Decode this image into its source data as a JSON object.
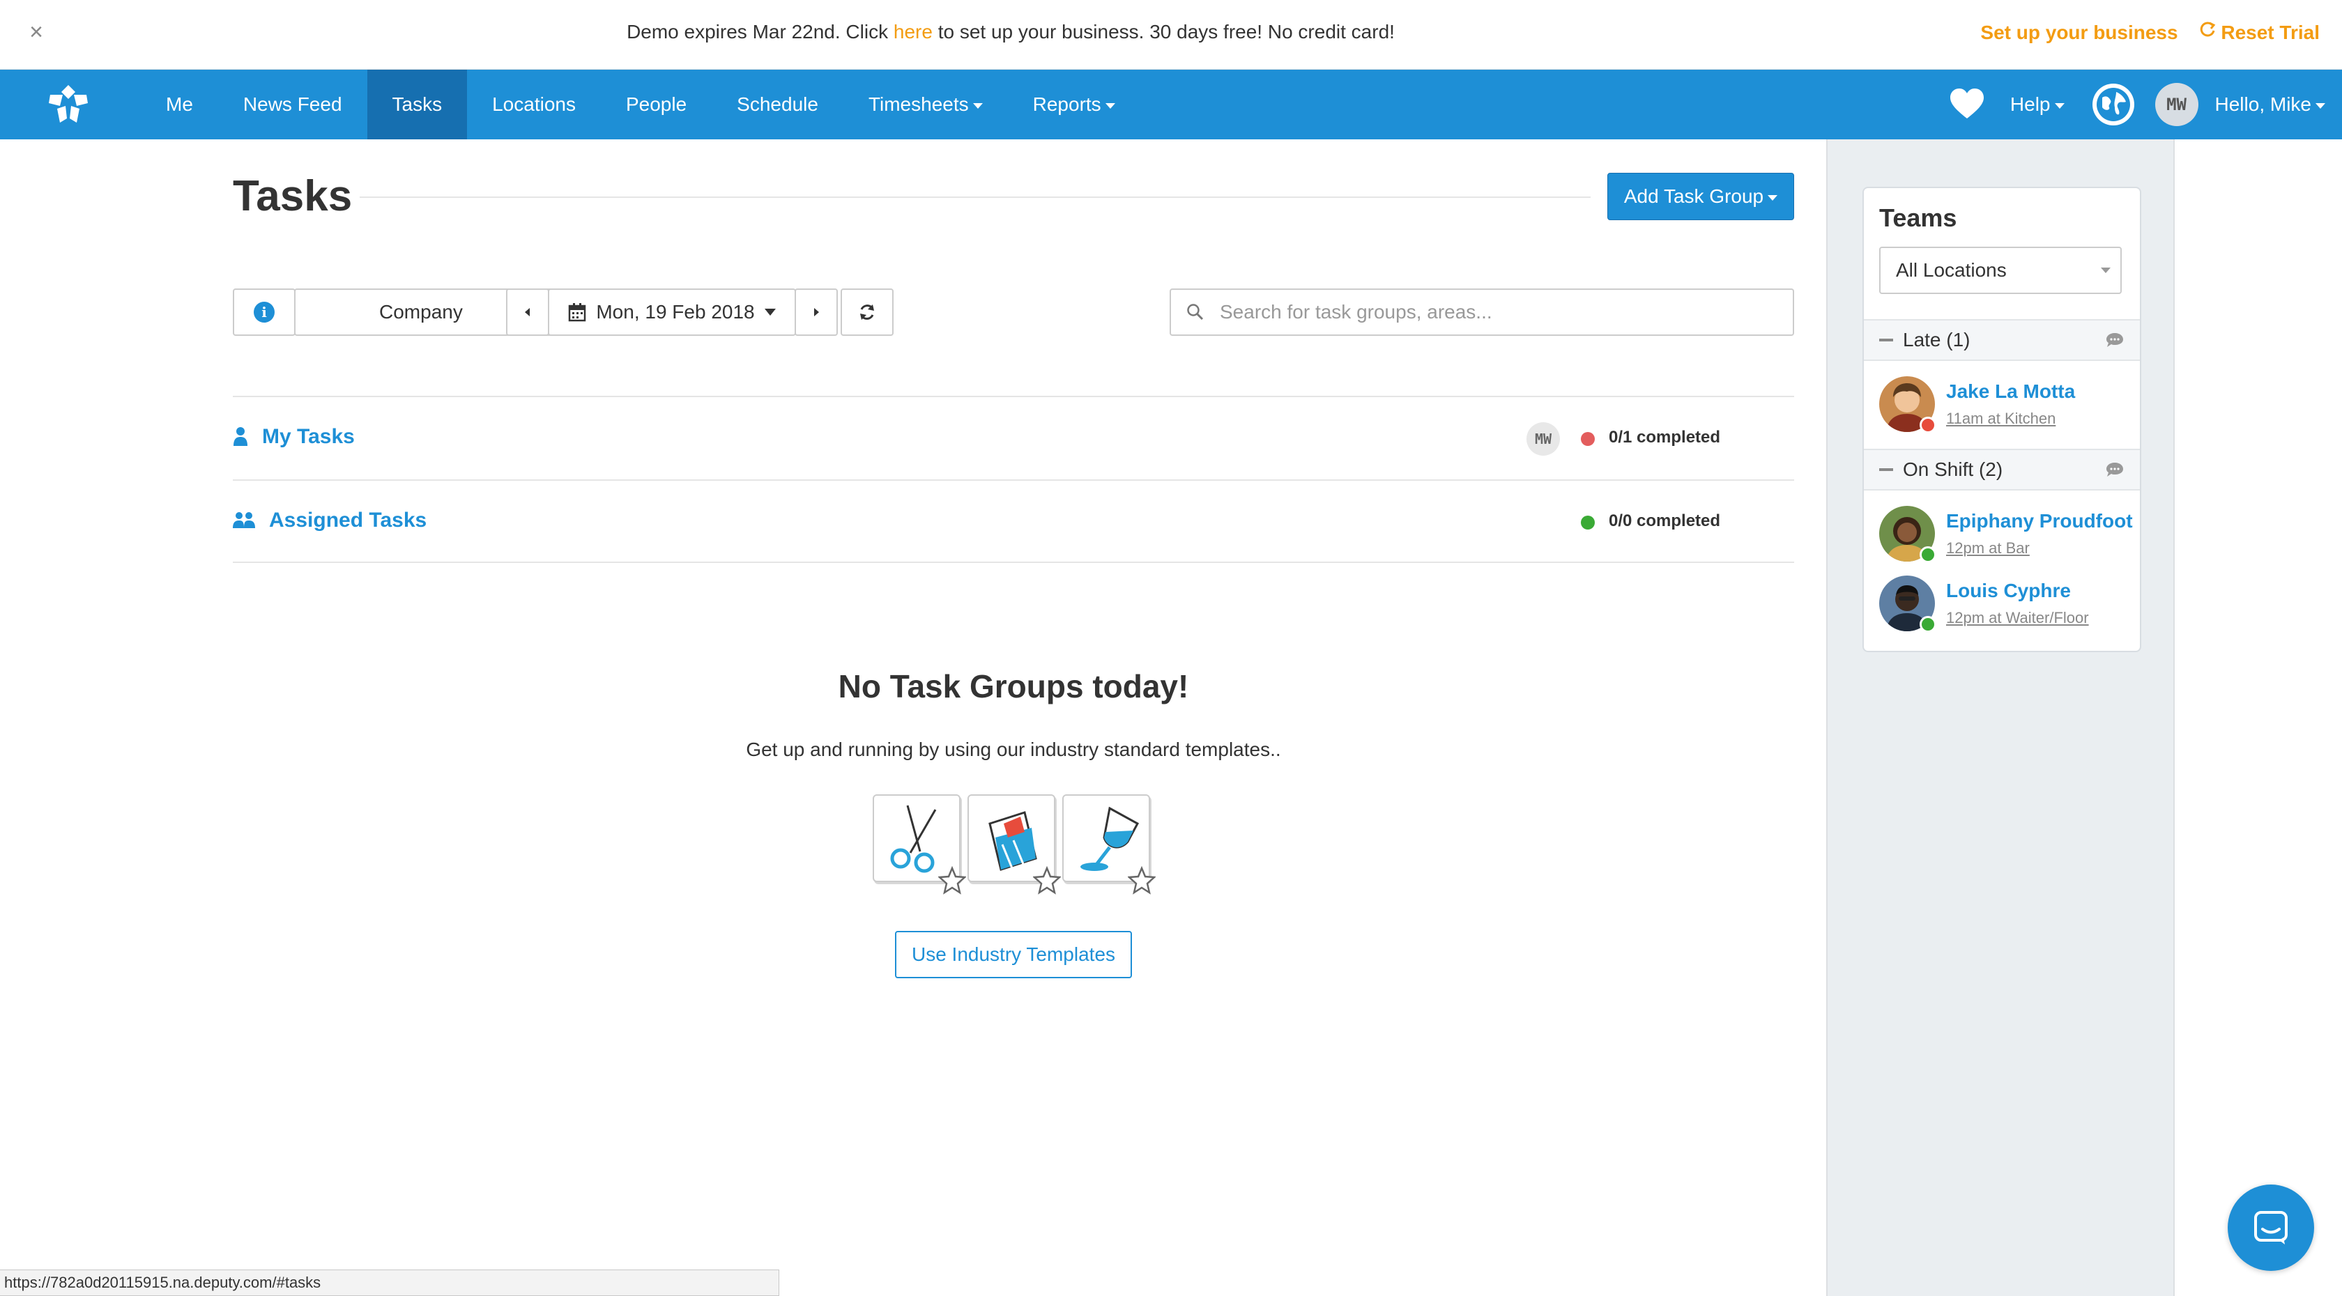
{
  "demo_bar": {
    "close": "×",
    "msg_pre": "Demo expires Mar 22nd. Click",
    "msg_link": "here",
    "msg_post": "to set up your business. 30 days free! No credit card!",
    "setup": "Set up your business",
    "reset": "Reset Trial"
  },
  "nav": {
    "items": [
      {
        "label": "Me"
      },
      {
        "label": "News Feed"
      },
      {
        "label": "Tasks",
        "active": true
      },
      {
        "label": "Locations"
      },
      {
        "label": "People"
      },
      {
        "label": "Schedule"
      },
      {
        "label": "Timesheets",
        "dropdown": true
      },
      {
        "label": "Reports",
        "dropdown": true
      }
    ],
    "help": "Help",
    "initials": "MW",
    "hello": "Hello, Mike"
  },
  "page": {
    "title": "Tasks",
    "add_button": "Add Task Group"
  },
  "toolbar": {
    "scope": "Company",
    "date": "Mon, 19 Feb 2018",
    "search_placeholder": "Search for task groups, areas..."
  },
  "task_rows": [
    {
      "label": "My Tasks",
      "initials": "MW",
      "status": "0/1 completed",
      "status_color": "#e35d5d"
    },
    {
      "label": "Assigned Tasks",
      "status": "0/0 completed",
      "status_color": "#3aaa35"
    }
  ],
  "empty_state": {
    "title": "No Task Groups today!",
    "subtitle": "Get up and running by using our industry standard templates..",
    "templates": [
      "scissors-icon",
      "food-wrap-icon",
      "wine-glass-icon"
    ],
    "button": "Use Industry Templates"
  },
  "teams": {
    "title": "Teams",
    "location": "All Locations",
    "groups": [
      {
        "label": "Late (1)",
        "people": [
          {
            "name": "Jake La Motta",
            "shift": "11am at Kitchen",
            "status_color": "#e74c3c"
          }
        ]
      },
      {
        "label": "On Shift (2)",
        "people": [
          {
            "name": "Epiphany Proudfoot",
            "shift": "12pm at Bar",
            "status_color": "#3aaa35"
          },
          {
            "name": "Louis Cyphre",
            "shift": "12pm at Waiter/Floor",
            "status_color": "#3aaa35"
          }
        ]
      }
    ]
  },
  "status_url": "https://782a0d20115915.na.deputy.com/#tasks",
  "colors": {
    "brand": "#1e8fd6",
    "accent": "#f39c12"
  }
}
